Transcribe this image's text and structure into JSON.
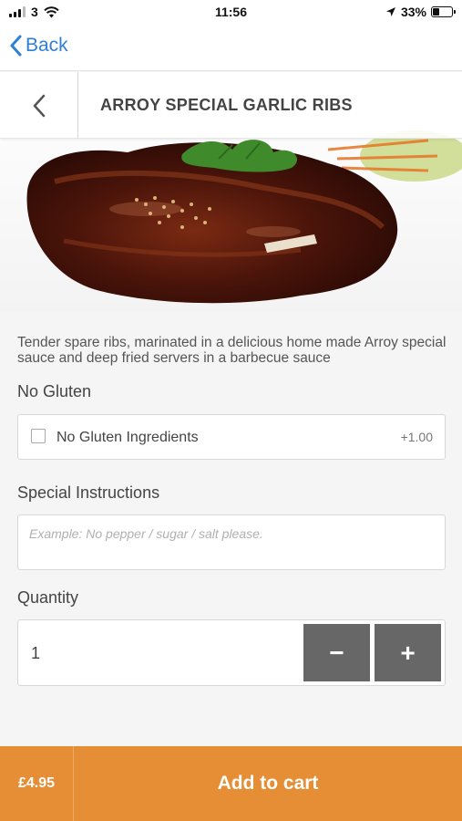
{
  "status_bar": {
    "carrier": "3",
    "time": "11:56",
    "battery": "33%"
  },
  "nav": {
    "back_label": "Back"
  },
  "item": {
    "title": "ARROY SPECIAL GARLIC RIBS",
    "description": "Tender spare ribs, marinated in a delicious home made Arroy special sauce and deep fried servers in a barbecue sauce"
  },
  "options": {
    "section_label": "No Gluten",
    "items": [
      {
        "label": "No Gluten Ingredients",
        "price": "+1.00",
        "checked": false
      }
    ]
  },
  "instructions": {
    "label": "Special Instructions",
    "placeholder": "Example: No pepper / sugar / salt please."
  },
  "quantity": {
    "label": "Quantity",
    "value": "1",
    "minus": "−",
    "plus": "+"
  },
  "cart": {
    "price": "£4.95",
    "label": "Add to cart",
    "color": "#e58e35"
  },
  "colors": {
    "link_blue": "#2f7fd6",
    "button_gray": "#676767"
  }
}
